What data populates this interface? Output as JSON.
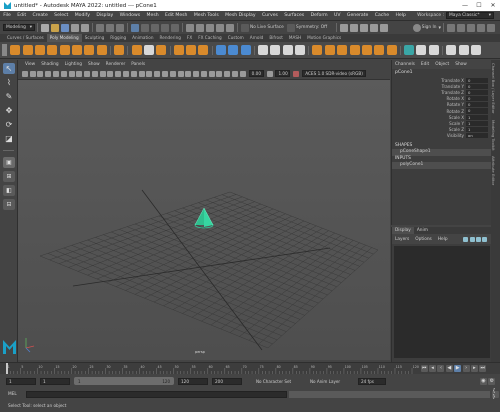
{
  "window": {
    "title": "untitled* - Autodesk MAYA 2022: untitled   ---   pCone1",
    "min": "—",
    "max": "☐",
    "close": "✕"
  },
  "menubar": {
    "items": [
      "File",
      "Edit",
      "Create",
      "Select",
      "Modify",
      "Display",
      "Windows",
      "Mesh",
      "Edit Mesh",
      "Mesh Tools",
      "Mesh Display",
      "Curves",
      "Surfaces",
      "Deform",
      "UV",
      "Generate",
      "Cache",
      "Help"
    ],
    "workspace_label": "Workspace :",
    "workspace_value": "Maya Classic*"
  },
  "statusline": {
    "mode": "Modeling",
    "no_live_surface": "No Live Surface",
    "symmetry": "Symmetry: Off",
    "sign_in": "Sign In"
  },
  "shelf": {
    "tabs": [
      "Curves / Surfaces",
      "Poly Modeling",
      "Sculpting",
      "Rigging",
      "Animation",
      "Rendering",
      "FX",
      "FX Caching",
      "Custom",
      "Arnold",
      "Bifrost",
      "MASH",
      "Motion Graphics"
    ],
    "active_tab": "Poly Modeling"
  },
  "viewport": {
    "menu": [
      "View",
      "Shading",
      "Lighting",
      "Show",
      "Renderer",
      "Panels"
    ],
    "camera_label": "persp",
    "exposure": "0.00",
    "gamma": "1.00",
    "color_space": "ACES 1.0 SDR-video (sRGB)"
  },
  "channelbox": {
    "menu": [
      "Channels",
      "Edit",
      "Object",
      "Show"
    ],
    "object": "pCone1",
    "attributes": [
      {
        "name": "Translate X",
        "value": "0"
      },
      {
        "name": "Translate Y",
        "value": "0"
      },
      {
        "name": "Translate Z",
        "value": "0"
      },
      {
        "name": "Rotate X",
        "value": "0"
      },
      {
        "name": "Rotate Y",
        "value": "0"
      },
      {
        "name": "Rotate Z",
        "value": "0"
      },
      {
        "name": "Scale X",
        "value": "1"
      },
      {
        "name": "Scale Y",
        "value": "1"
      },
      {
        "name": "Scale Z",
        "value": "1"
      },
      {
        "name": "Visibility",
        "value": "on"
      }
    ],
    "shapes_header": "SHAPES",
    "shape_node": "pConeShape1",
    "inputs_header": "INPUTS",
    "input_node": "polyCone1"
  },
  "layer_editor": {
    "tabs": [
      "Display",
      "Anim"
    ],
    "menu": [
      "Layers",
      "Options",
      "Help"
    ]
  },
  "side_tabs": [
    "Channel Box / Layer Editor",
    "Modeling Toolkit",
    "Attribute Editor"
  ],
  "timeslider": {
    "ticks": [
      "1",
      "5",
      "10",
      "15",
      "20",
      "25",
      "30",
      "35",
      "40",
      "45",
      "50",
      "55",
      "60",
      "65",
      "70",
      "75",
      "80",
      "85",
      "90",
      "95",
      "100",
      "105",
      "110",
      "115",
      "120"
    ],
    "current_frame": "1"
  },
  "range": {
    "start": "1",
    "inner_start": "1",
    "range_start_field": "1",
    "range_end_field": "120",
    "outer_end": "120",
    "anim_end": "200",
    "character_set": "No Character Set",
    "anim_layer": "No Anim Layer",
    "fps": "24 fps"
  },
  "cmdline": {
    "mel_label": "MEL"
  },
  "helpline": {
    "text": "Select Tool: select an object"
  },
  "colors": {
    "accent_blue": "#5d7fa8",
    "cone_green": "#2ecc9a",
    "maya_teal": "#1aa0c7"
  }
}
